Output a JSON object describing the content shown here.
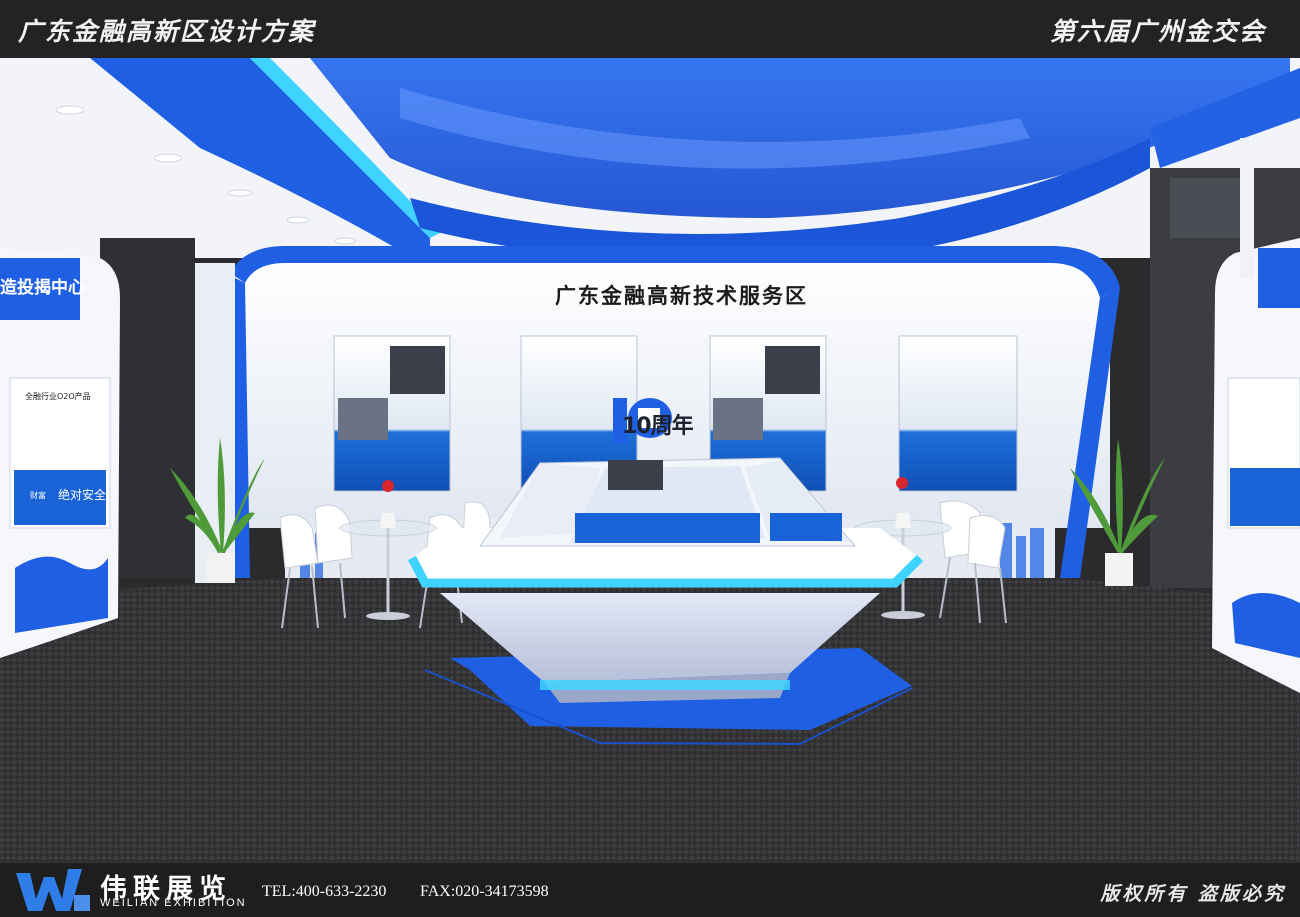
{
  "header": {
    "left_title": "广东金融高新区设计方案",
    "right_title": "第六届广州金交会"
  },
  "booth": {
    "main_sign": "广东金融高新技术服务区",
    "left_side_sign": "造投揭中心",
    "anniversary": "10周年",
    "poster_text": "全融行业O2O产品",
    "slogan": "绝对安全",
    "slogan_sub": "财富"
  },
  "footer": {
    "logo_cn": "伟联展览",
    "logo_en": "WEILIAN EXHIBITION",
    "tel": "TEL:400-633-2230",
    "fax": "FAX:020-34173598",
    "copyright": "版权所有  盗版必究"
  },
  "colors": {
    "accent_blue": "#1e5fe0",
    "glow_cyan": "#3fd4ff",
    "wall_white": "#eef2f8"
  }
}
